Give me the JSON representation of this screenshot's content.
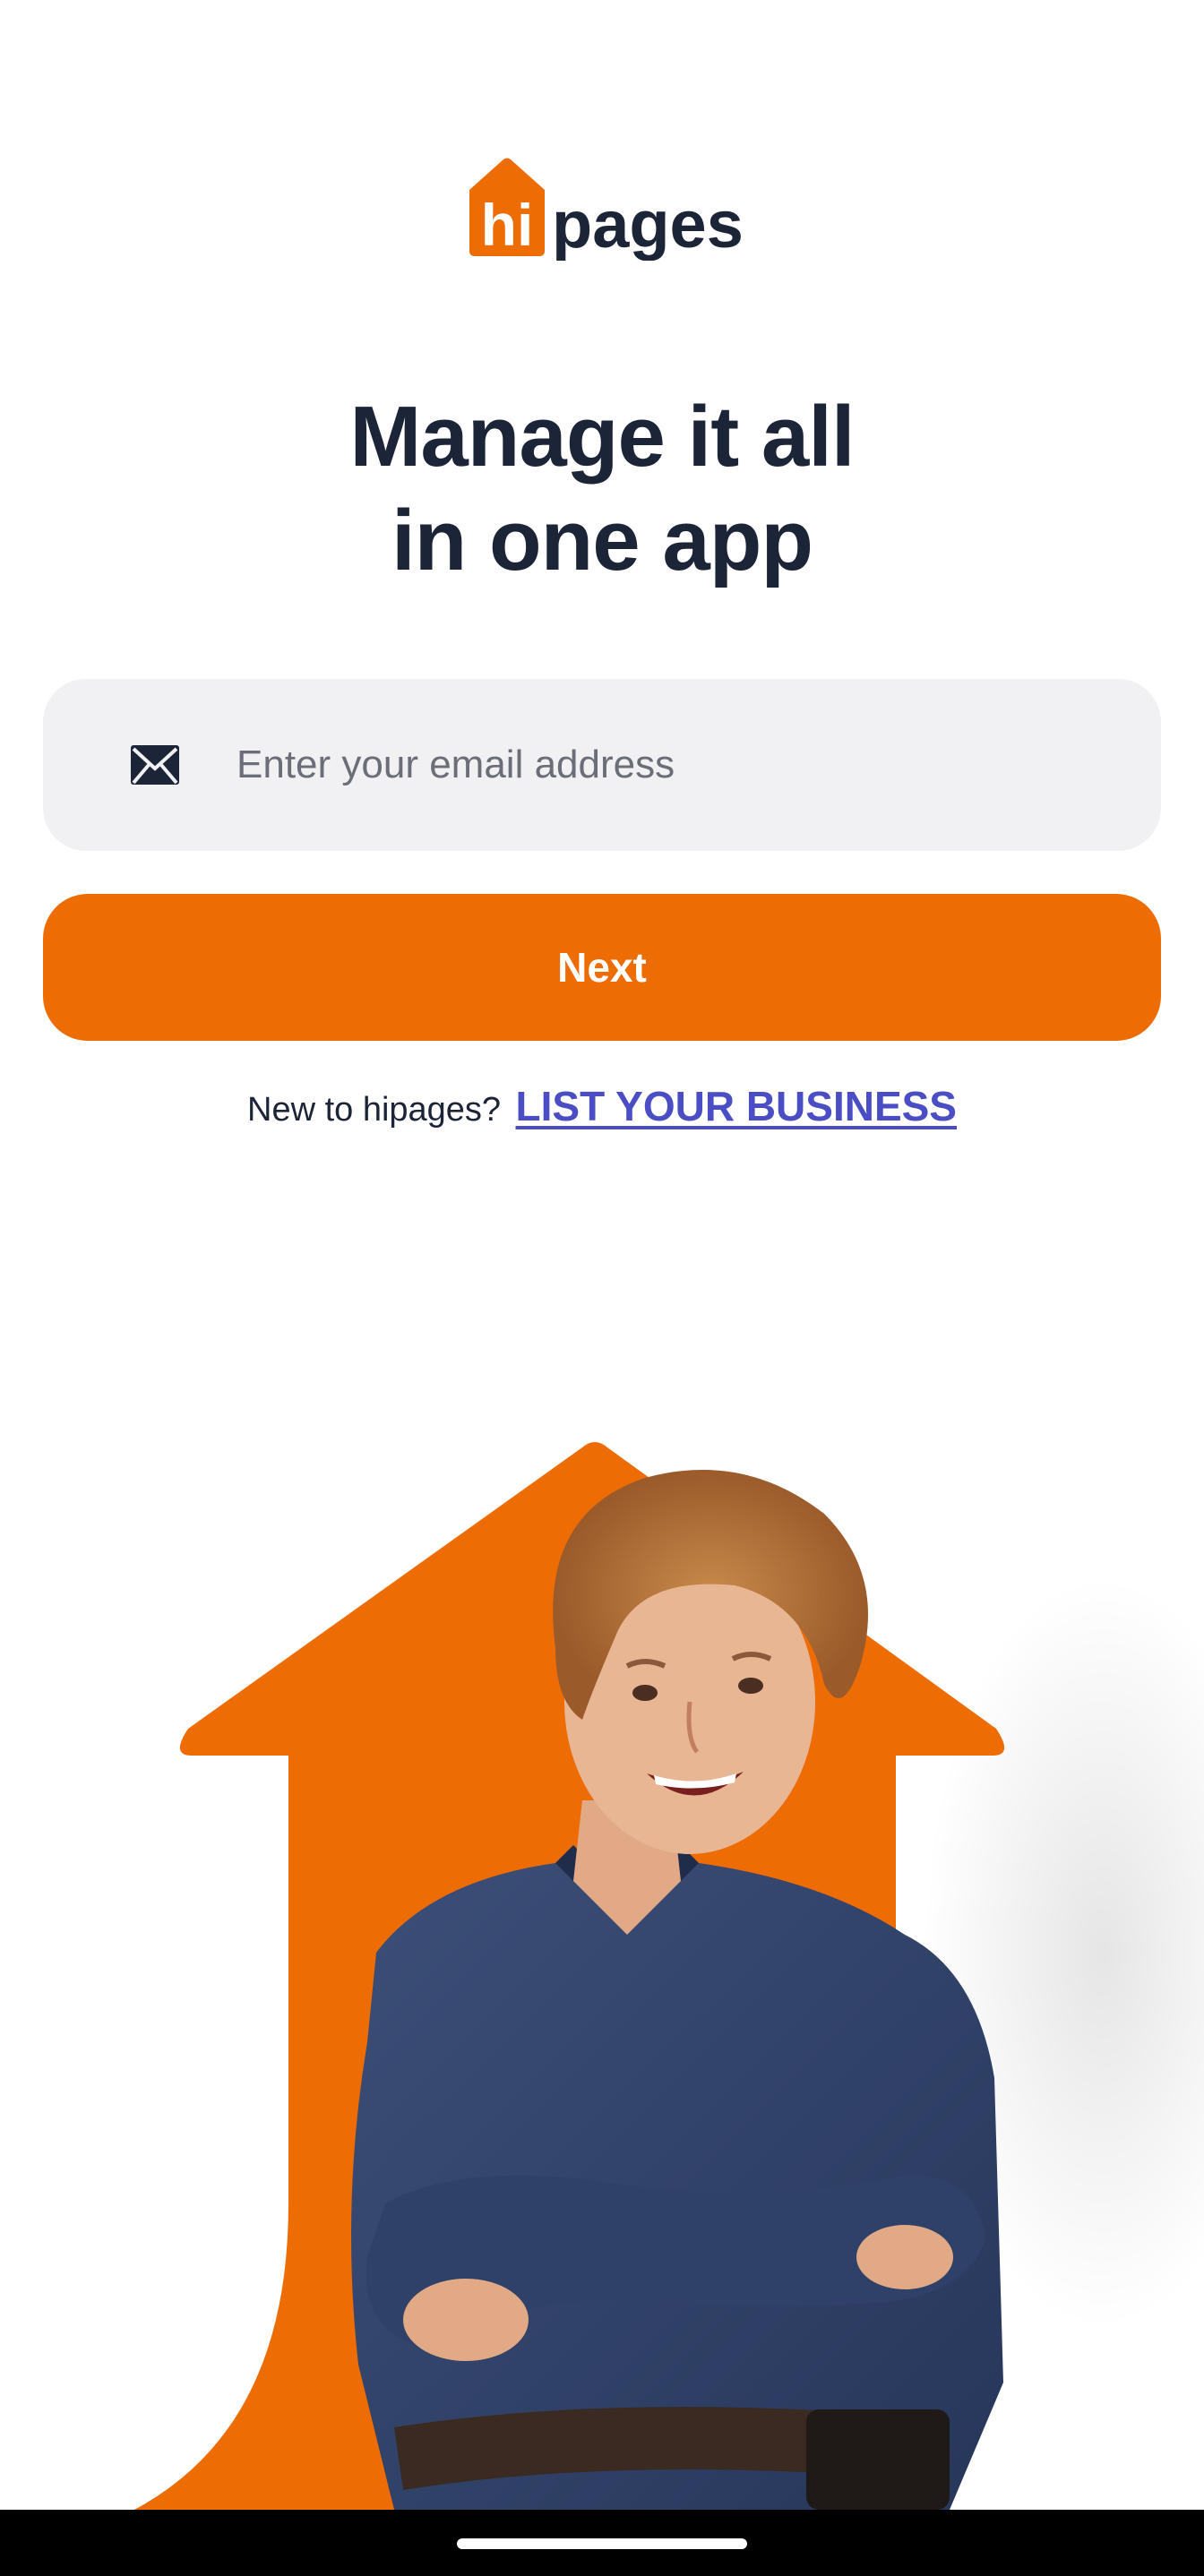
{
  "brand": {
    "logo_prefix": "hi",
    "logo_suffix": "pages",
    "accent_color": "#ee6c04",
    "text_color": "#1c2537"
  },
  "headline": {
    "line1": "Manage it all",
    "line2": "in one app"
  },
  "email": {
    "icon": "envelope-icon",
    "placeholder": "Enter your email address",
    "value": ""
  },
  "next_button": {
    "label": "Next"
  },
  "signup": {
    "prompt": "New to hipages?",
    "link_label": "LIST YOUR BUSINESS",
    "link_color": "#4a4dc4"
  },
  "hero": {
    "illustration": "tradesperson-with-arrow"
  }
}
